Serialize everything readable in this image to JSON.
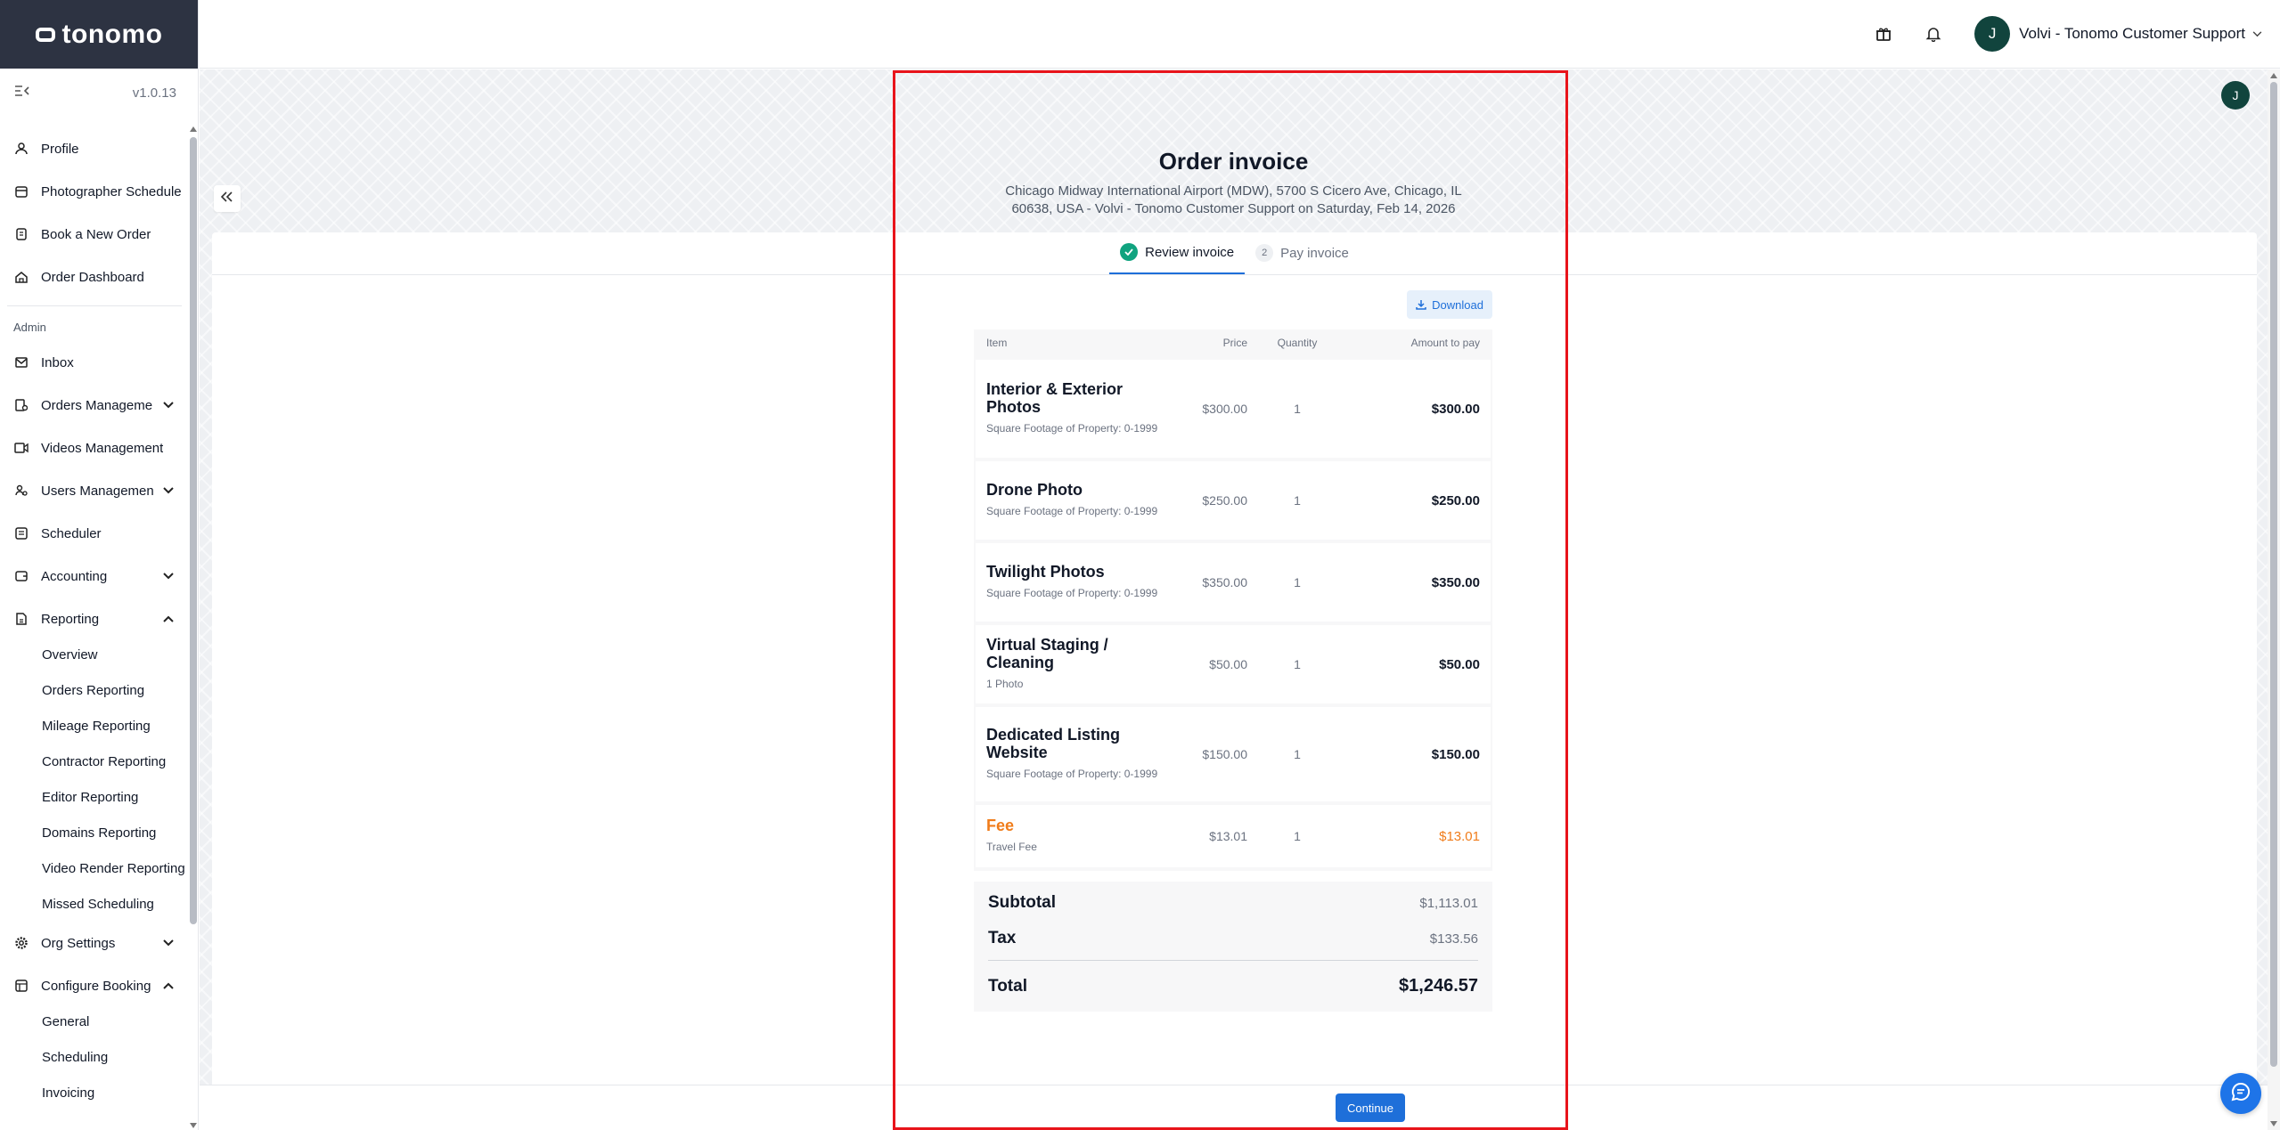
{
  "app": {
    "brand": "tonomo",
    "version": "v1.0.13"
  },
  "header": {
    "user_name": "Volvi - Tonomo Customer Support",
    "avatar_initial": "J"
  },
  "sidebar": {
    "items_top": [
      {
        "label": "Profile",
        "icon": "user-icon"
      },
      {
        "label": "Photographer Schedule",
        "icon": "calendar-icon"
      },
      {
        "label": "Book a New Order",
        "icon": "book-icon"
      },
      {
        "label": "Order Dashboard",
        "icon": "home-icon"
      }
    ],
    "admin_label": "Admin",
    "items_admin": [
      {
        "label": "Inbox",
        "icon": "mail-icon"
      },
      {
        "label": "Orders Management",
        "icon": "orders-icon",
        "expand": "down"
      },
      {
        "label": "Videos Management",
        "icon": "video-icon"
      },
      {
        "label": "Users Management",
        "icon": "users-icon",
        "expand": "down"
      },
      {
        "label": "Scheduler",
        "icon": "scheduler-icon"
      },
      {
        "label": "Accounting",
        "icon": "wallet-icon",
        "expand": "down"
      },
      {
        "label": "Reporting",
        "icon": "report-icon",
        "expand": "up"
      }
    ],
    "reporting_sub": [
      "Overview",
      "Orders Reporting",
      "Mileage Reporting",
      "Contractor Reporting",
      "Editor Reporting",
      "Domains Reporting",
      "Video Render Reporting",
      "Missed Scheduling"
    ],
    "items_bottom": [
      {
        "label": "Org Settings",
        "icon": "gear-icon",
        "expand": "down"
      },
      {
        "label": "Configure Booking",
        "icon": "grid-icon",
        "expand": "up"
      }
    ],
    "booking_sub": [
      "General",
      "Scheduling",
      "Invoicing"
    ]
  },
  "page": {
    "title": "Order invoice",
    "subtitle": "Chicago Midway International Airport (MDW), 5700 S Cicero Ave, Chicago, IL 60638, USA - Volvi - Tonomo Customer Support on Saturday, Feb 14, 2026",
    "tabs": [
      {
        "label": "Review invoice",
        "state": "complete"
      },
      {
        "number": "2",
        "label": "Pay invoice",
        "state": "pending"
      }
    ],
    "download_label": "Download",
    "continue_label": "Continue"
  },
  "invoice": {
    "columns": [
      "Item",
      "Price",
      "Quantity",
      "Amount to pay"
    ],
    "rows": [
      {
        "name": "Interior & Exterior Photos",
        "desc": "Square Footage of Property: 0-1999",
        "price": "$300.00",
        "qty": "1",
        "amount": "$300.00"
      },
      {
        "name": "Drone Photo",
        "desc": "Square Footage of Property: 0-1999",
        "price": "$250.00",
        "qty": "1",
        "amount": "$250.00"
      },
      {
        "name": "Twilight Photos",
        "desc": "Square Footage of Property: 0-1999",
        "price": "$350.00",
        "qty": "1",
        "amount": "$350.00"
      },
      {
        "name": "Virtual Staging / Cleaning",
        "desc": "1 Photo",
        "price": "$50.00",
        "qty": "1",
        "amount": "$50.00"
      },
      {
        "name": "Dedicated Listing Website",
        "desc": "Square Footage of Property: 0-1999",
        "price": "$150.00",
        "qty": "1",
        "amount": "$150.00"
      },
      {
        "name": "Fee",
        "desc": "Travel Fee",
        "price": "$13.01",
        "qty": "1",
        "amount": "$13.01"
      }
    ],
    "subtotal_label": "Subtotal",
    "subtotal": "$1,113.01",
    "tax_label": "Tax",
    "tax": "$133.56",
    "total_label": "Total",
    "total": "$1,246.57"
  },
  "colors": {
    "accent": "#1e6fd9",
    "fee": "#f07c1a",
    "success": "#10a37f",
    "highlight": "#e8141b",
    "sidebar_header": "#2d3342"
  }
}
